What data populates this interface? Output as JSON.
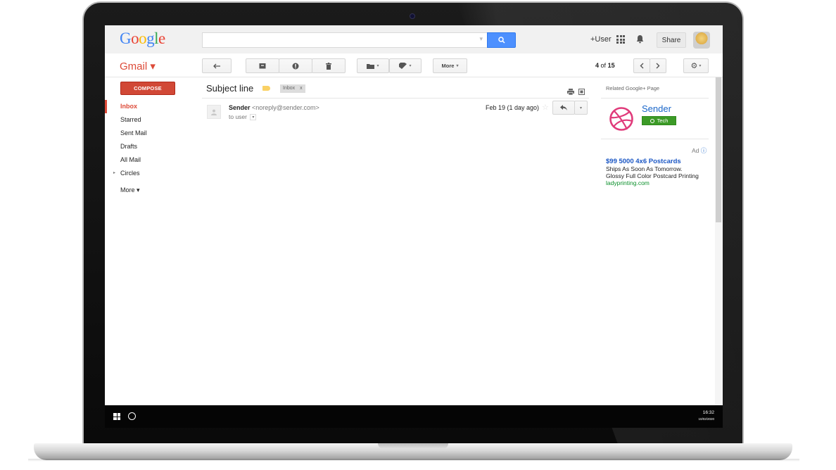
{
  "header": {
    "logo_letters": [
      "G",
      "o",
      "o",
      "g",
      "l",
      "e"
    ],
    "plus_user": "+User",
    "share_label": "Share"
  },
  "toolbar": {
    "app_label": "Gmail ▾",
    "more_label": "More",
    "page_current": "4",
    "page_of": "of",
    "page_total": "15"
  },
  "nav": {
    "compose_label": "COMPOSE",
    "items": [
      {
        "label": "Inbox",
        "active": true
      },
      {
        "label": "Starred"
      },
      {
        "label": "Sent Mail"
      },
      {
        "label": "Drafts"
      },
      {
        "label": "All Mail"
      },
      {
        "label": "Circles"
      }
    ],
    "more_label": "More ▾"
  },
  "message": {
    "subject": "Subject line",
    "label_chip": "Inbox",
    "label_chip_close": "x",
    "sender_name": "Sender",
    "sender_email": "<noreply@sender.com>",
    "to_line": "to user",
    "date": "Feb 19 (1 day ago)"
  },
  "right_panel": {
    "related_label": "Related Google+ Page",
    "page_name": "Sender",
    "follow_label": "Tech",
    "ad_label": "Ad",
    "ad_title": "$99 5000 4x6 Postcards",
    "ad_line1": "Ships As Soon As Tomorrow.",
    "ad_line2": "Glossy Full Color Postcard Printing",
    "ad_url": "ladyprinting.com"
  },
  "taskbar": {
    "time": "16:32",
    "date": "10/02/2020"
  },
  "colors": {
    "accent_red": "#dd4b39",
    "compose_red": "#d14836",
    "search_blue": "#4d90fe",
    "link_blue": "#1a56c4",
    "ad_green": "#0a8f2a",
    "follow_green": "#3c9a27",
    "label_yellow": "#fad165"
  }
}
